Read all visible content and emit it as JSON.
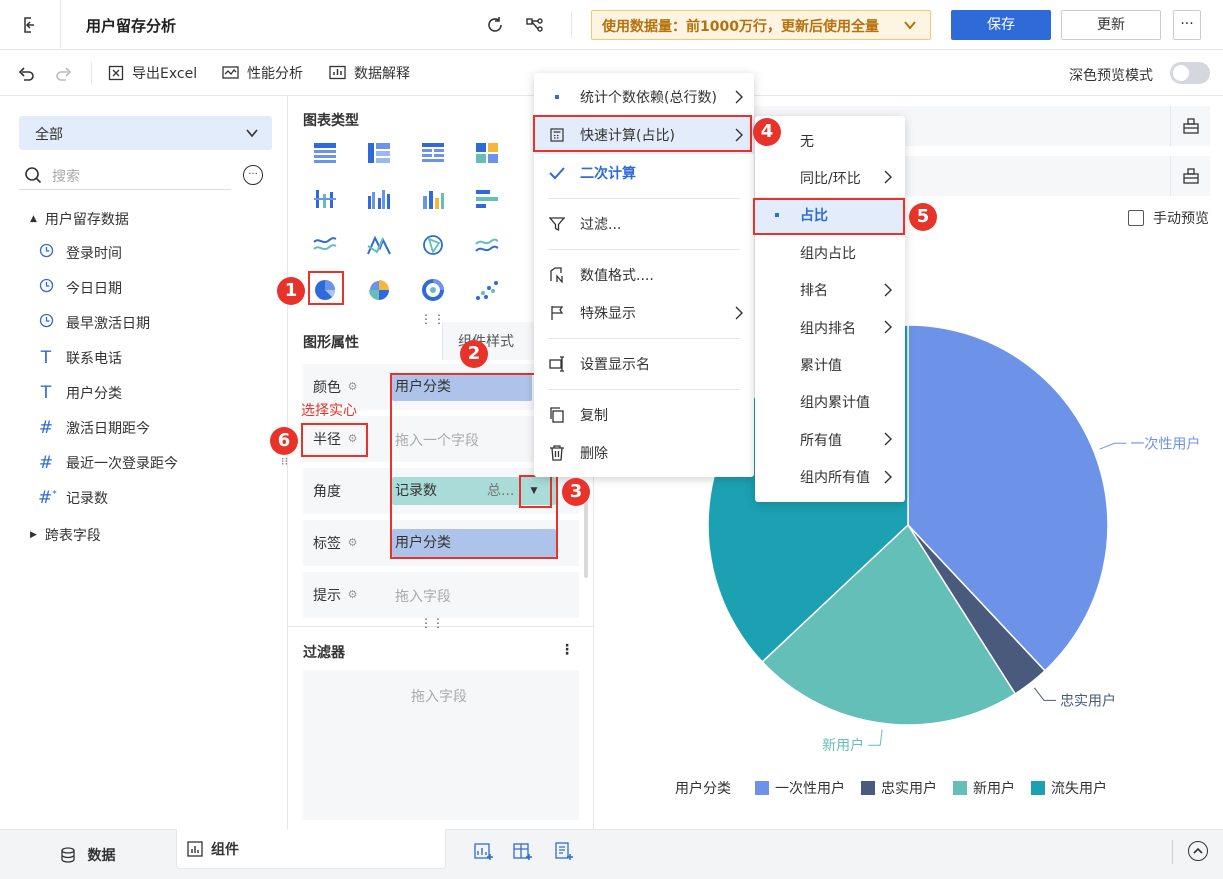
{
  "header": {
    "title": "用户留存分析",
    "notice": "使用数据量：前1000万行，更新后使用全量",
    "save_label": "保存",
    "update_label": "更新",
    "more_label": "···"
  },
  "toolbar": {
    "export_excel": "导出Excel",
    "performance": "性能分析",
    "data_explain": "数据解释",
    "dark_preview": "深色预览模式"
  },
  "left": {
    "scope_select": "全部",
    "search_placeholder": "搜索",
    "dataset_name": "用户留存数据",
    "fields": [
      {
        "icon": "clock",
        "label": "登录时间"
      },
      {
        "icon": "clock",
        "label": "今日日期"
      },
      {
        "icon": "clock",
        "label": "最早激活日期"
      },
      {
        "icon": "T",
        "label": "联系电话"
      },
      {
        "icon": "T",
        "label": "用户分类"
      },
      {
        "icon": "#",
        "label": "激活日期距今"
      },
      {
        "icon": "#",
        "label": "最近一次登录距今"
      },
      {
        "icon": "#*",
        "label": "记录数"
      }
    ],
    "cross_table": "跨表字段"
  },
  "mid": {
    "chart_type_title": "图表类型",
    "graph_props_tab": "图形属性",
    "component_style_tab": "组件样式",
    "props": {
      "color_label": "颜色",
      "color_value": "用户分类",
      "radius_label": "半径",
      "radius_placeholder": "拖入一个字段",
      "angle_label": "角度",
      "angle_value": "记录数",
      "angle_agg": "总...",
      "label_label": "标签",
      "label_value": "用户分类",
      "tip_label": "提示",
      "tip_placeholder": "拖入字段"
    },
    "annotation_solid": "选择实心",
    "filter_title": "过滤器",
    "filter_placeholder": "拖入字段"
  },
  "menu1": {
    "items": [
      {
        "label": "统计个数依赖(总行数)",
        "icon": "dot",
        "submenu": true
      },
      {
        "label": "快速计算(占比)",
        "icon": "calc",
        "submenu": true
      },
      {
        "label": "二次计算",
        "icon": "check",
        "submenu": false
      },
      {
        "label": "过滤...",
        "icon": "filter",
        "submenu": false
      },
      {
        "label": "数值格式....",
        "icon": "format",
        "submenu": false
      },
      {
        "label": "特殊显示",
        "icon": "flag",
        "submenu": true
      },
      {
        "label": "设置显示名",
        "icon": "rename",
        "submenu": false
      },
      {
        "label": "复制",
        "icon": "copy",
        "submenu": false
      },
      {
        "label": "删除",
        "icon": "trash",
        "submenu": false
      }
    ]
  },
  "menu2": {
    "items": [
      {
        "label": "无",
        "submenu": false
      },
      {
        "label": "同比/环比",
        "submenu": true
      },
      {
        "label": "占比",
        "submenu": false,
        "selected": true
      },
      {
        "label": "组内占比",
        "submenu": false
      },
      {
        "label": "排名",
        "submenu": true
      },
      {
        "label": "组内排名",
        "submenu": true
      },
      {
        "label": "累计值",
        "submenu": false
      },
      {
        "label": "组内累计值",
        "submenu": false
      },
      {
        "label": "所有值",
        "submenu": true
      },
      {
        "label": "组内所有值",
        "submenu": true
      }
    ]
  },
  "preview": {
    "manual_preview": "手动预览"
  },
  "badges": [
    "1",
    "2",
    "3",
    "4",
    "5",
    "6"
  ],
  "chart_data": {
    "type": "pie",
    "title": "",
    "legend_title": "用户分类",
    "legend_position": "bottom",
    "categories": [
      "一次性用户",
      "忠实用户",
      "新用户",
      "流失用户"
    ],
    "values": [
      38,
      3,
      22,
      37
    ],
    "colors": [
      "#6d93e8",
      "#4a5a7d",
      "#63bfb7",
      "#1ba1b1"
    ],
    "slice_labels": [
      "一次性用户",
      "忠实用户",
      "新用户",
      ""
    ]
  },
  "bottom": {
    "tab_data": "数据",
    "tab_component": "组件"
  },
  "colors": {
    "primary": "#2f6bd8",
    "danger": "#e8332b",
    "chip_blue": "#aec3ea",
    "chip_teal": "#a9dcd8"
  }
}
